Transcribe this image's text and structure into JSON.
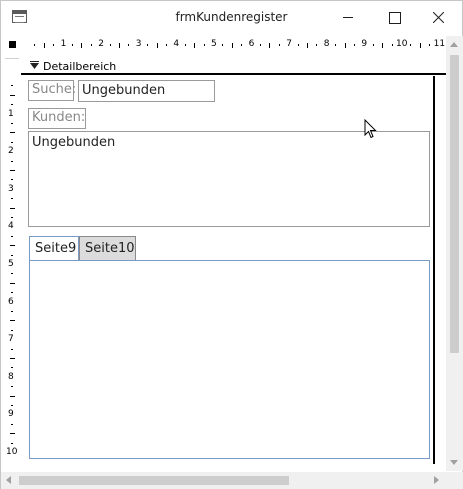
{
  "window": {
    "title": "frmKundenregister"
  },
  "ruler": {
    "horizontal_numbers": [
      "1",
      "2",
      "3",
      "4",
      "5",
      "6",
      "7",
      "8",
      "9",
      "10",
      "11"
    ],
    "vertical_numbers": [
      "1",
      "2",
      "3",
      "4",
      "5",
      "6",
      "7",
      "8",
      "9",
      "10"
    ]
  },
  "section": {
    "label": "Detailbereich"
  },
  "controls": {
    "search_label": "Suche:",
    "search_value": "Ungebunden",
    "customers_label": "Kunden:",
    "customers_list_value": "Ungebunden"
  },
  "tabs": [
    {
      "label": "Seite9",
      "active": true
    },
    {
      "label": "Seite10",
      "active": false
    }
  ],
  "icons": {
    "app": "form-icon",
    "section": "section-arrow-icon",
    "cursor": "mouse-pointer-icon"
  }
}
